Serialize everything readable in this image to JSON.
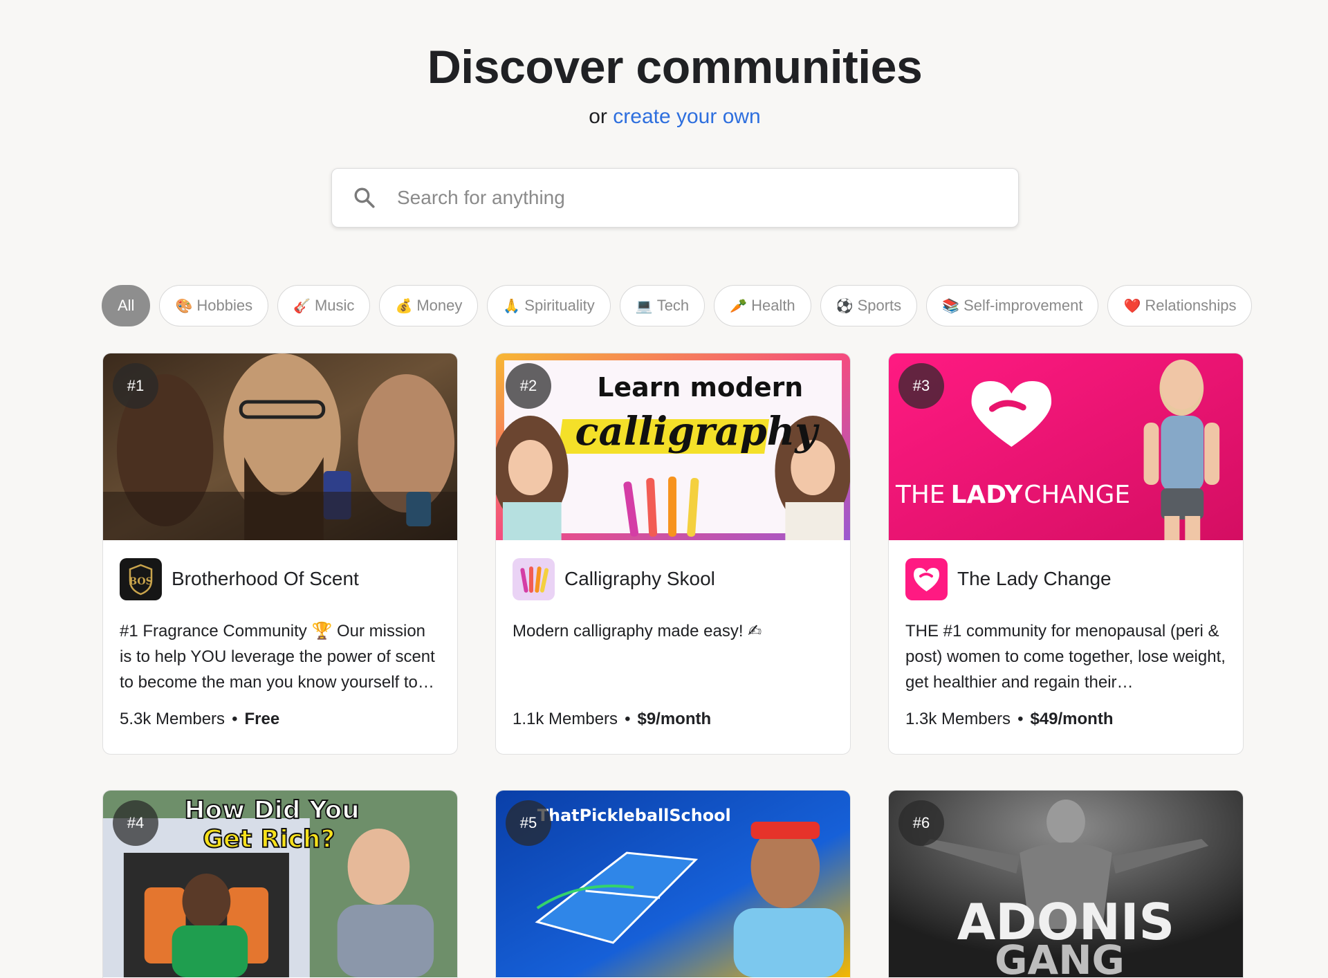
{
  "header": {
    "title": "Discover communities",
    "sub_prefix": "or",
    "sub_link": "create your own"
  },
  "search": {
    "placeholder": "Search for anything",
    "icon": "search-icon"
  },
  "categories": [
    {
      "label": "All",
      "emoji": ""
    },
    {
      "label": "Hobbies",
      "emoji": "🎨"
    },
    {
      "label": "Music",
      "emoji": "🎸"
    },
    {
      "label": "Money",
      "emoji": "💰"
    },
    {
      "label": "Spirituality",
      "emoji": "🙏"
    },
    {
      "label": "Tech",
      "emoji": "💻"
    },
    {
      "label": "Health",
      "emoji": "🥕"
    },
    {
      "label": "Sports",
      "emoji": "⚽"
    },
    {
      "label": "Self-improvement",
      "emoji": "📚"
    },
    {
      "label": "Relationships",
      "emoji": "❤️"
    }
  ],
  "cards": [
    {
      "rank": "#1",
      "name": "Brotherhood Of Scent",
      "description": "#1 Fragrance Community 🏆 Our mission is to help YOU leverage the power of scent to become the man you know yourself to…",
      "members": "5.3k Members",
      "price": "Free"
    },
    {
      "rank": "#2",
      "name": "Calligraphy Skool",
      "description": "Modern calligraphy made easy! ✍",
      "members": "1.1k Members",
      "price": "$9/month",
      "thumb_text_top": "Learn modern",
      "thumb_text_bottom": "calligraphy"
    },
    {
      "rank": "#3",
      "name": "The Lady Change",
      "description": "THE #1 community for menopausal (peri & post) women to come together, lose weight, get healthier and regain their…",
      "members": "1.3k Members",
      "price": "$49/month",
      "thumb_text_a": "THE",
      "thumb_text_b": "LADY",
      "thumb_text_c": "CHANGE"
    },
    {
      "rank": "#4",
      "thumb_text_a": "How Did You",
      "thumb_text_b": "Get Rich?"
    },
    {
      "rank": "#5",
      "thumb_text_a": "ThatPickleballSchool"
    },
    {
      "rank": "#6",
      "thumb_text_a": "ADONIS",
      "thumb_text_b": "GANG"
    }
  ],
  "colors": {
    "link": "#2e6fde",
    "lady_change_pink": "#e8146c",
    "chip_active": "#8e8e8e"
  }
}
